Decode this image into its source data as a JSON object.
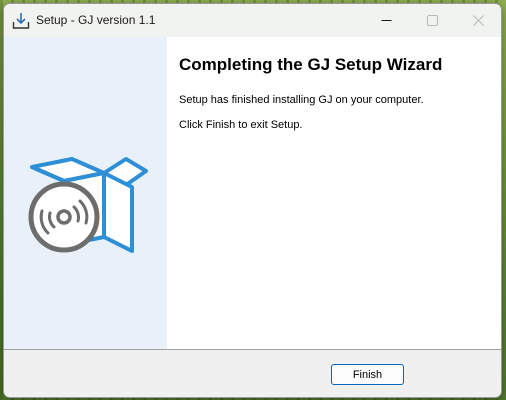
{
  "window": {
    "title": "Setup - GJ version 1.1",
    "app_icon": "download-tray-icon",
    "controls": [
      "minimize-icon",
      "maximize-icon",
      "close-icon"
    ]
  },
  "sidebar": {
    "image": "software-box-with-disc-icon",
    "background": "#e8f1f9"
  },
  "content": {
    "heading": "Completing the GJ Setup Wizard",
    "message_1": "Setup has finished installing GJ on your computer.",
    "message_2": "Click Finish to exit Setup."
  },
  "footer": {
    "finish_label": "Finish"
  },
  "colors": {
    "accent": "#0067c0",
    "box_blue": "#2e8fd6",
    "disc_gray": "#6d6d6d"
  }
}
